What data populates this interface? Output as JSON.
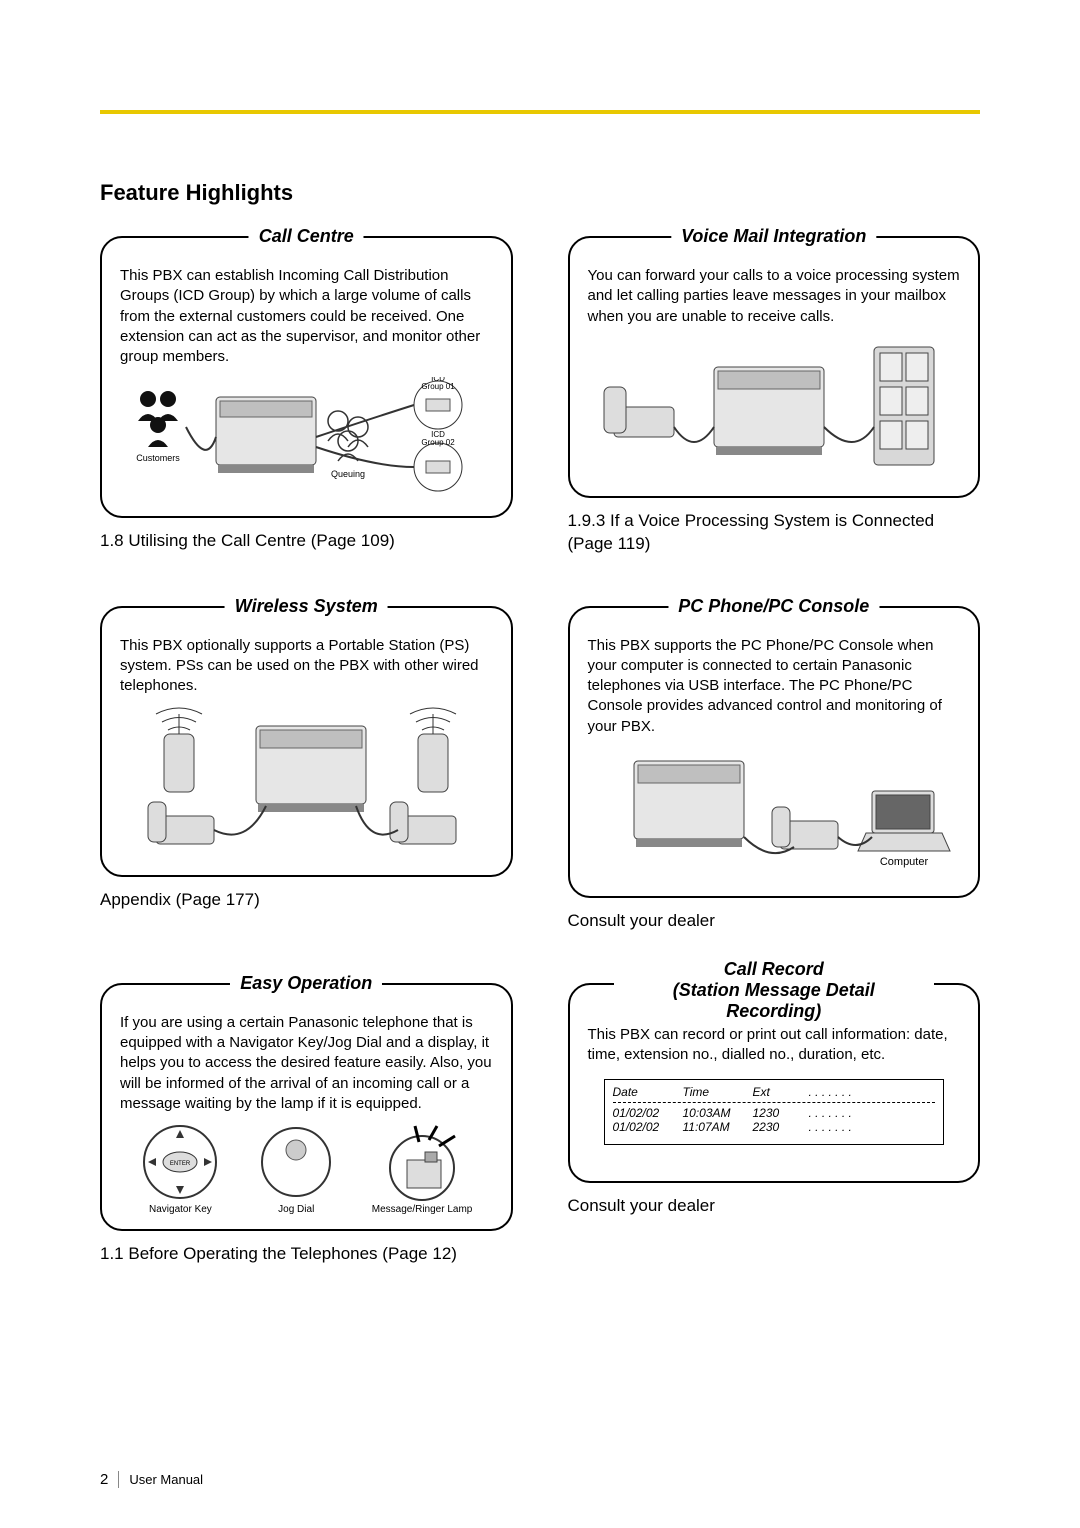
{
  "page": {
    "title": "Feature Highlights",
    "page_number": "2",
    "footer_label": "User Manual"
  },
  "features": [
    {
      "title": "Call Centre",
      "text": "This PBX can establish Incoming Call Distribution Groups (ICD Group) by which a large volume of calls from the external customers could be received. One extension can act as the supervisor, and monitor other group members.",
      "caption": "1.8 Utilising the Call Centre (Page 109)",
      "labels": {
        "customers": "Customers",
        "queuing": "Queuing",
        "group1": "ICD\nGroup 01",
        "group2": "ICD\nGroup 02"
      }
    },
    {
      "title": "Voice Mail Integration",
      "text": "You can forward your calls to a voice processing system and let calling parties leave messages in your mailbox when you are unable to receive calls.",
      "caption": "1.9.3 If a Voice Processing System is Connected (Page 119)"
    },
    {
      "title": "Wireless System",
      "text": "This PBX optionally supports a Portable Station (PS) system. PSs can be used on the PBX with other wired telephones.",
      "caption": "Appendix (Page 177)"
    },
    {
      "title": "PC Phone/PC Console",
      "text": "This PBX supports the PC Phone/PC Console when your computer is connected to certain Panasonic telephones via USB interface. The PC Phone/PC Console provides advanced control and monitoring of your PBX.",
      "caption": "Consult your dealer",
      "labels": {
        "computer": "Computer"
      }
    },
    {
      "title": "Easy Operation",
      "text": "If you are using a certain Panasonic telephone that is equipped with a Navigator Key/Jog Dial and a display, it helps you to access the desired feature easily. Also, you will be informed of the arrival of an incoming call or a message waiting by the lamp if it is equipped.",
      "caption": "1.1 Before Operating the Telephones (Page 12)",
      "labels": {
        "nav": "Navigator Key",
        "jog": "Jog Dial",
        "lamp": "Message/Ringer Lamp",
        "enter": "ENTER"
      }
    },
    {
      "title": "Call Record",
      "subtitle": "(Station Message Detail Recording)",
      "text": "This PBX can record or print out call information: date, time, extension no., dialled no., duration, etc.",
      "caption": "Consult your dealer",
      "table": {
        "headers": [
          "Date",
          "Time",
          "Ext",
          ". . . . . . ."
        ],
        "rows": [
          [
            "01/02/02",
            "10:03AM",
            "1230",
            ". . . . . . ."
          ],
          [
            "01/02/02",
            "11:07AM",
            "2230",
            ". . . . . . ."
          ]
        ]
      }
    }
  ]
}
